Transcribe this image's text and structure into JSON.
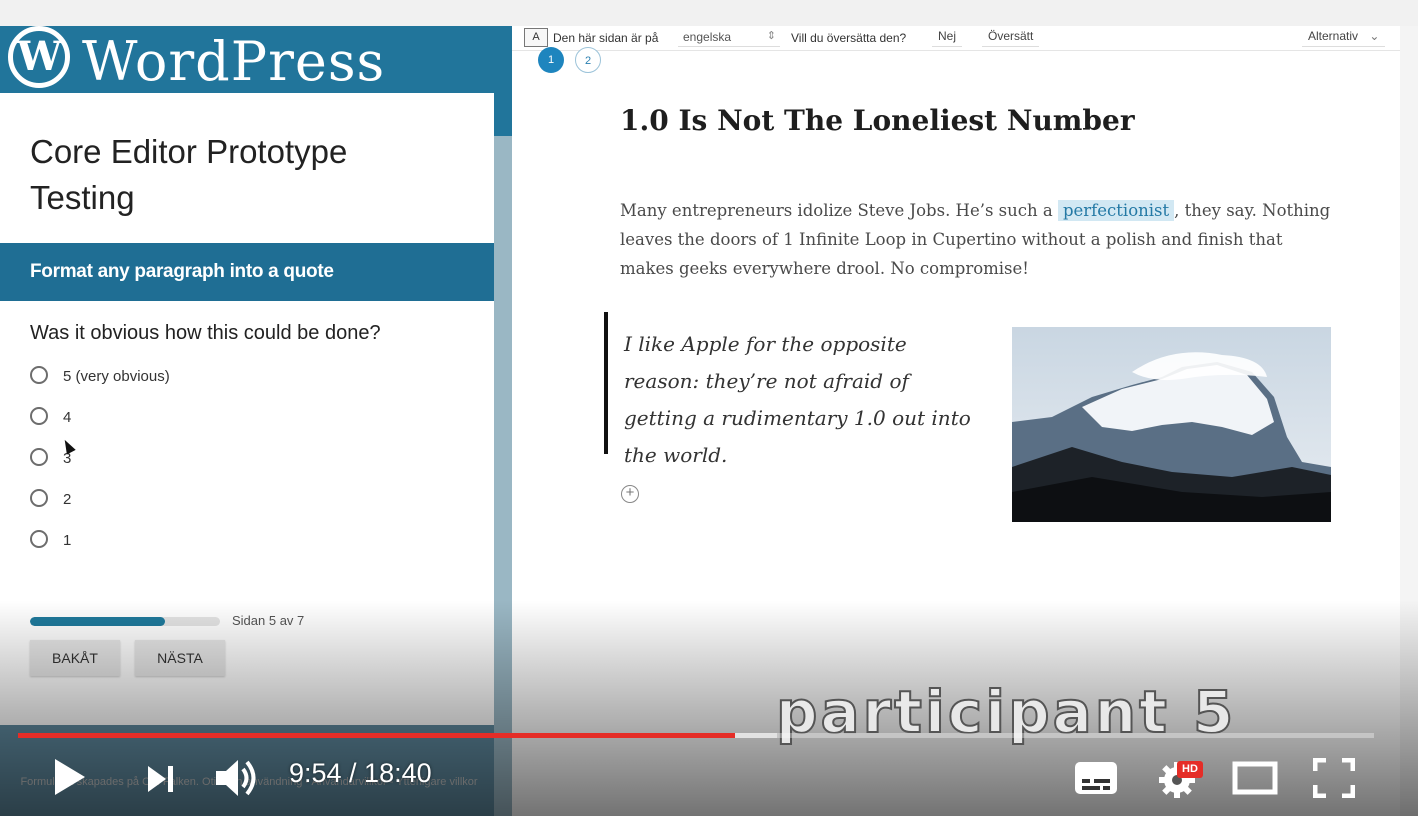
{
  "wordpress": {
    "logo_letter": "W",
    "wordmark": "WordPress"
  },
  "form": {
    "title": "Core Editor Prototype Testing",
    "section_heading": "Format any paragraph into a quote",
    "question": "Was it obvious how this could be done?",
    "options": [
      {
        "label": "5 (very obvious)",
        "selected": false
      },
      {
        "label": "4",
        "selected": false
      },
      {
        "label": "3",
        "selected": false
      },
      {
        "label": "2",
        "selected": false
      },
      {
        "label": "1",
        "selected": false
      }
    ],
    "progress_fraction": 0.71,
    "page_indicator": "Sidan 5 av 7",
    "back_button": "BAKÅT",
    "next_button": "NÄSTA",
    "footer_note": "Formuläret skapades på Om Falken. Otillåten användning - Användarvillkor - Ytterligare villkor"
  },
  "translate_bar": {
    "icon_label": "A",
    "prefix": "Den här sidan är på",
    "language": "engelska",
    "question": "Vill du översätta den?",
    "no_button": "Nej",
    "translate_button": "Översätt",
    "options_button": "Alternativ"
  },
  "editor": {
    "steps": [
      "1",
      "2"
    ],
    "post_title": "1.0 Is Not The Loneliest Number",
    "paragraph_before": "Many entrepreneurs idolize Steve Jobs. He’s such a ",
    "paragraph_highlight": "perfectionist",
    "paragraph_after": ", they say. Nothing leaves the doors of 1 Infinite Loop in Cupertino without a polish and finish that makes geeks everywhere drool. No compromise!",
    "quote": "I like Apple for the opposite reason: they’re not afraid of getting a rudimentary 1.0 out into the world.",
    "add_block_symbol": "+",
    "image_subject": "snowy mountain peak"
  },
  "player": {
    "watermark": "participant 5",
    "time_display": "9:54 / 18:40",
    "progress_fraction": 0.529,
    "buffered_fraction": 0.56,
    "hd_badge": "HD",
    "colors": {
      "played": "#e52d27",
      "hd_badge": "#e52d27"
    }
  }
}
